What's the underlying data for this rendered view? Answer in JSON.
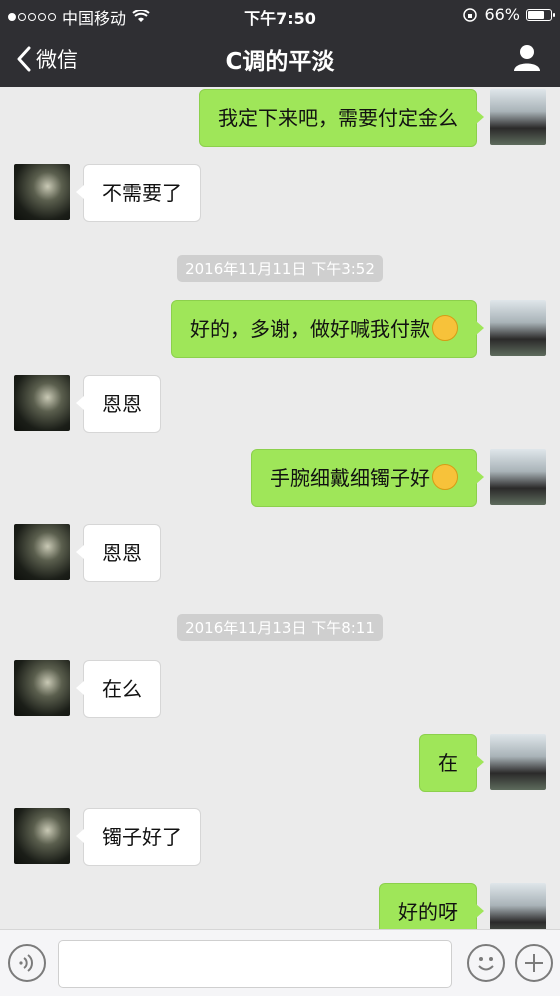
{
  "status_bar": {
    "carrier": "中国移动",
    "time": "下午7:50",
    "battery": "66%",
    "signal_dots_filled": 1,
    "signal_dots_total": 5,
    "battery_level": 0.66
  },
  "nav": {
    "back_label": "微信",
    "title": "C调的平淡"
  },
  "messages": [
    {
      "side": "right",
      "text": "我定下来吧，需要付定金么"
    },
    {
      "side": "left",
      "text": "不需要了"
    },
    {
      "type": "timestamp",
      "text": "2016年11月11日 下午3:52"
    },
    {
      "side": "right",
      "text": "好的，多谢，做好喊我付款",
      "emoji": "grin-emoji"
    },
    {
      "side": "left",
      "text": "恩恩"
    },
    {
      "side": "right",
      "text": "手腕细戴细镯子好",
      "emoji": "smile-emoji"
    },
    {
      "side": "left",
      "text": "恩恩"
    },
    {
      "type": "timestamp",
      "text": "2016年11月13日 下午8:11"
    },
    {
      "side": "left",
      "text": "在么"
    },
    {
      "side": "right",
      "text": "在"
    },
    {
      "side": "left",
      "text": "镯子好了"
    },
    {
      "side": "right",
      "text": "好的呀"
    }
  ],
  "colors": {
    "header_bg": "#2f2f33",
    "chat_bg": "#ebebeb",
    "sent_bubble": "#9fe659",
    "received_bubble": "#ffffff"
  },
  "icons": {
    "back": "chevron-left-icon",
    "profile": "person-icon",
    "voice": "voice-icon",
    "emoji": "emoji-icon",
    "more": "plus-icon"
  }
}
